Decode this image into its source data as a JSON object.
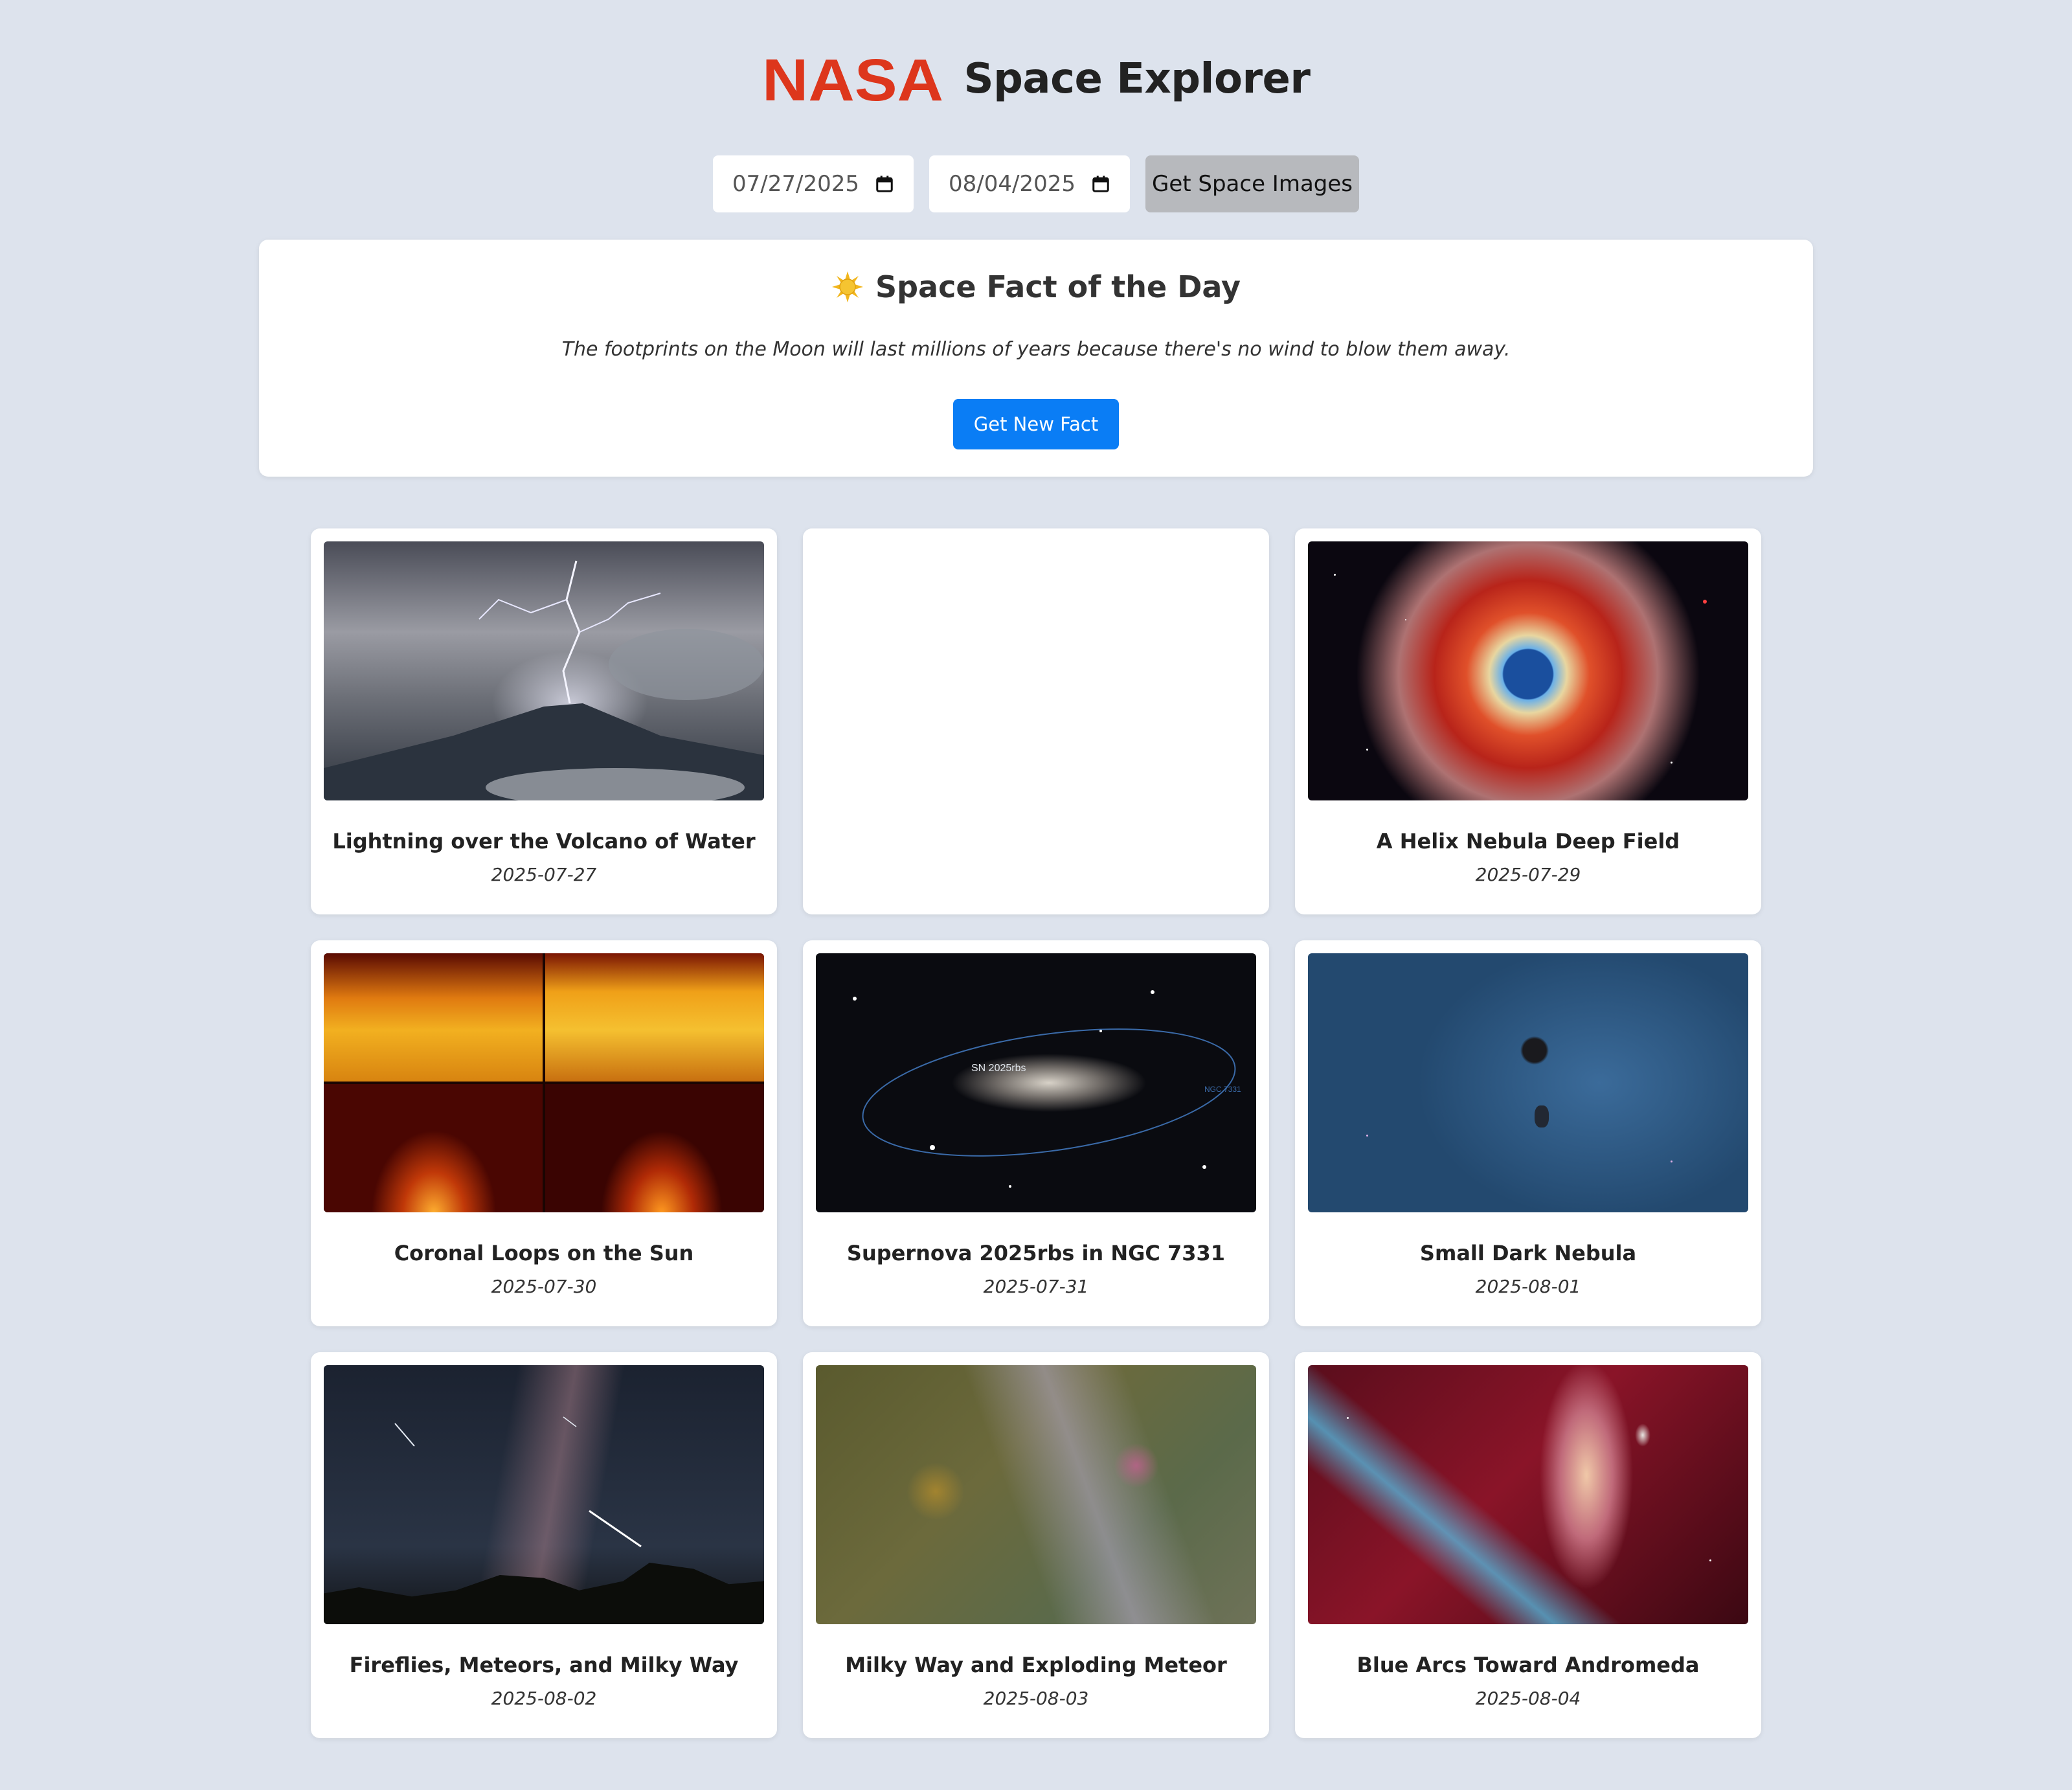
{
  "app": {
    "logo_text": "NASA",
    "title": "Space Explorer",
    "logo_color": "#dd361c"
  },
  "controls": {
    "start_date": "07/27/2025",
    "end_date": "08/04/2025",
    "submit_label": "Get Space Images",
    "calendar_icon": "calendar-icon"
  },
  "fact": {
    "icon": "sun-icon",
    "title": "Space Fact of the Day",
    "text": "The footprints on the Moon will last millions of years because there's no wind to blow them away.",
    "button_label": "Get New Fact",
    "button_color": "#0a7df5"
  },
  "gallery": [
    {
      "title": "Lightning over the Volcano of Water",
      "date": "2025-07-27"
    },
    {
      "title": "",
      "date": ""
    },
    {
      "title": "A Helix Nebula Deep Field",
      "date": "2025-07-29"
    },
    {
      "title": "Coronal Loops on the Sun",
      "date": "2025-07-30"
    },
    {
      "title": "Supernova 2025rbs in NGC 7331",
      "date": "2025-07-31",
      "image_labels": [
        "SN 2025rbs",
        "NGC 7331"
      ]
    },
    {
      "title": "Small Dark Nebula",
      "date": "2025-08-01"
    },
    {
      "title": "Fireflies, Meteors, and Milky Way",
      "date": "2025-08-02"
    },
    {
      "title": "Milky Way and Exploding Meteor",
      "date": "2025-08-03"
    },
    {
      "title": "Blue Arcs Toward Andromeda",
      "date": "2025-08-04"
    }
  ]
}
